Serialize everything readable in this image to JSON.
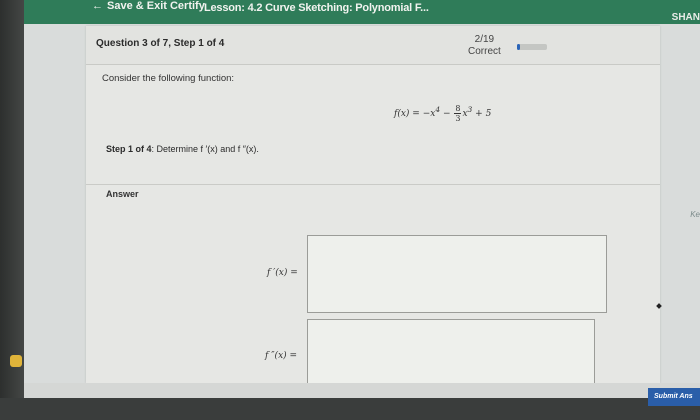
{
  "topbar": {
    "back_label": "Save & Exit Certify",
    "lesson_title": "Lesson: 4.2 Curve Sketching: Polynomial F...",
    "user_name": "SHAN"
  },
  "question": {
    "number_text": "Question 3 of 7, Step 1 of 4",
    "score": "2/19",
    "score_status": "Correct",
    "progress_fraction": 0.105,
    "prompt": "Consider the following function:",
    "formula": {
      "lhs": "f(x) = −x",
      "exp1": "4",
      "minus": " − ",
      "frac_num": "8",
      "frac_den": "3",
      "x": "x",
      "exp2": "3",
      "tail": " + 5"
    },
    "step_label": "Step 1 of 4",
    "step_text": ": Determine f ′(x) and f ″(x)."
  },
  "answer": {
    "label": "Answer",
    "fprime_label": "f ′(x) =",
    "fdoubleprime_label": "f ″(x) =",
    "fprime_value": "",
    "fdoubleprime_value": ""
  },
  "side": {
    "keypad_hint": "Ke"
  },
  "submit_label": "Submit Ans",
  "colors": {
    "topbar": "#2f7c59",
    "accent": "#2a64b8",
    "submit": "#2a5ea9"
  },
  "dock": [
    {
      "icon": "app-icon-yellow",
      "color": "#e0b43a"
    },
    {
      "icon": "app-icon-blue",
      "color": "#3a6cc7"
    },
    {
      "icon": "app-icon-dark",
      "color": "#1f1f1f"
    }
  ]
}
